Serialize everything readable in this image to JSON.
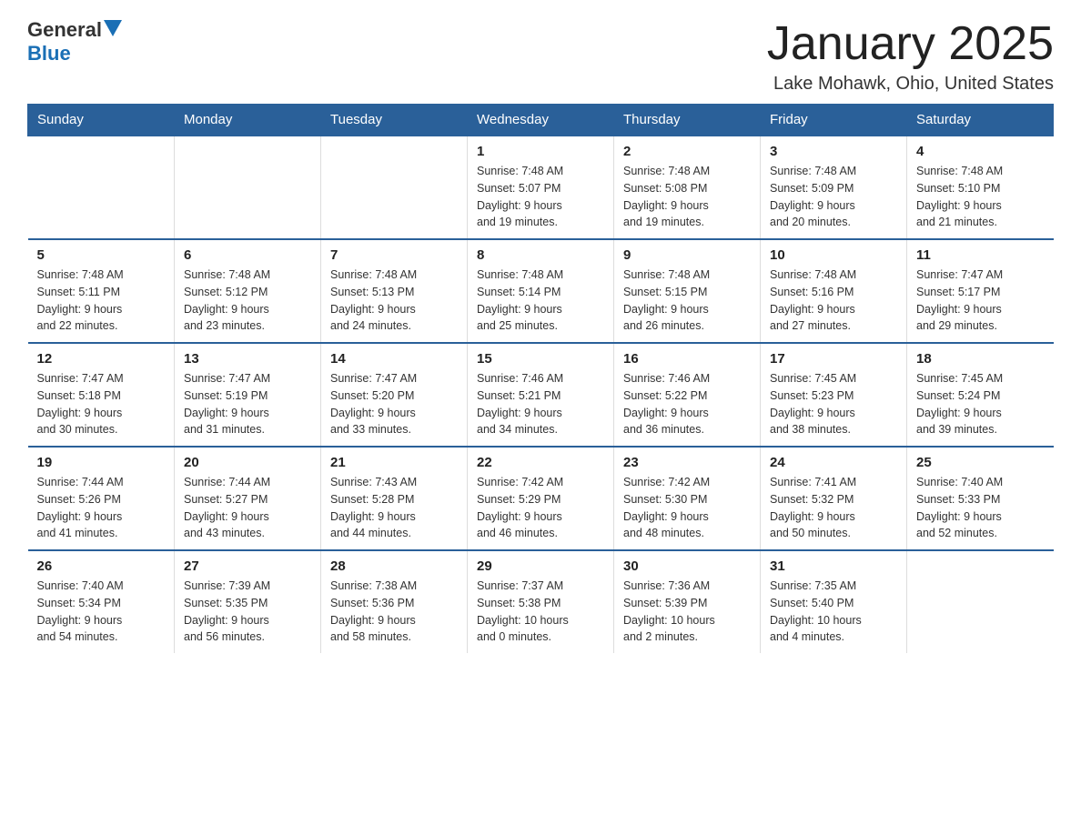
{
  "logo": {
    "general": "General",
    "blue": "Blue"
  },
  "title": "January 2025",
  "subtitle": "Lake Mohawk, Ohio, United States",
  "days_of_week": [
    "Sunday",
    "Monday",
    "Tuesday",
    "Wednesday",
    "Thursday",
    "Friday",
    "Saturday"
  ],
  "weeks": [
    [
      {
        "day": "",
        "info": ""
      },
      {
        "day": "",
        "info": ""
      },
      {
        "day": "",
        "info": ""
      },
      {
        "day": "1",
        "info": "Sunrise: 7:48 AM\nSunset: 5:07 PM\nDaylight: 9 hours\nand 19 minutes."
      },
      {
        "day": "2",
        "info": "Sunrise: 7:48 AM\nSunset: 5:08 PM\nDaylight: 9 hours\nand 19 minutes."
      },
      {
        "day": "3",
        "info": "Sunrise: 7:48 AM\nSunset: 5:09 PM\nDaylight: 9 hours\nand 20 minutes."
      },
      {
        "day": "4",
        "info": "Sunrise: 7:48 AM\nSunset: 5:10 PM\nDaylight: 9 hours\nand 21 minutes."
      }
    ],
    [
      {
        "day": "5",
        "info": "Sunrise: 7:48 AM\nSunset: 5:11 PM\nDaylight: 9 hours\nand 22 minutes."
      },
      {
        "day": "6",
        "info": "Sunrise: 7:48 AM\nSunset: 5:12 PM\nDaylight: 9 hours\nand 23 minutes."
      },
      {
        "day": "7",
        "info": "Sunrise: 7:48 AM\nSunset: 5:13 PM\nDaylight: 9 hours\nand 24 minutes."
      },
      {
        "day": "8",
        "info": "Sunrise: 7:48 AM\nSunset: 5:14 PM\nDaylight: 9 hours\nand 25 minutes."
      },
      {
        "day": "9",
        "info": "Sunrise: 7:48 AM\nSunset: 5:15 PM\nDaylight: 9 hours\nand 26 minutes."
      },
      {
        "day": "10",
        "info": "Sunrise: 7:48 AM\nSunset: 5:16 PM\nDaylight: 9 hours\nand 27 minutes."
      },
      {
        "day": "11",
        "info": "Sunrise: 7:47 AM\nSunset: 5:17 PM\nDaylight: 9 hours\nand 29 minutes."
      }
    ],
    [
      {
        "day": "12",
        "info": "Sunrise: 7:47 AM\nSunset: 5:18 PM\nDaylight: 9 hours\nand 30 minutes."
      },
      {
        "day": "13",
        "info": "Sunrise: 7:47 AM\nSunset: 5:19 PM\nDaylight: 9 hours\nand 31 minutes."
      },
      {
        "day": "14",
        "info": "Sunrise: 7:47 AM\nSunset: 5:20 PM\nDaylight: 9 hours\nand 33 minutes."
      },
      {
        "day": "15",
        "info": "Sunrise: 7:46 AM\nSunset: 5:21 PM\nDaylight: 9 hours\nand 34 minutes."
      },
      {
        "day": "16",
        "info": "Sunrise: 7:46 AM\nSunset: 5:22 PM\nDaylight: 9 hours\nand 36 minutes."
      },
      {
        "day": "17",
        "info": "Sunrise: 7:45 AM\nSunset: 5:23 PM\nDaylight: 9 hours\nand 38 minutes."
      },
      {
        "day": "18",
        "info": "Sunrise: 7:45 AM\nSunset: 5:24 PM\nDaylight: 9 hours\nand 39 minutes."
      }
    ],
    [
      {
        "day": "19",
        "info": "Sunrise: 7:44 AM\nSunset: 5:26 PM\nDaylight: 9 hours\nand 41 minutes."
      },
      {
        "day": "20",
        "info": "Sunrise: 7:44 AM\nSunset: 5:27 PM\nDaylight: 9 hours\nand 43 minutes."
      },
      {
        "day": "21",
        "info": "Sunrise: 7:43 AM\nSunset: 5:28 PM\nDaylight: 9 hours\nand 44 minutes."
      },
      {
        "day": "22",
        "info": "Sunrise: 7:42 AM\nSunset: 5:29 PM\nDaylight: 9 hours\nand 46 minutes."
      },
      {
        "day": "23",
        "info": "Sunrise: 7:42 AM\nSunset: 5:30 PM\nDaylight: 9 hours\nand 48 minutes."
      },
      {
        "day": "24",
        "info": "Sunrise: 7:41 AM\nSunset: 5:32 PM\nDaylight: 9 hours\nand 50 minutes."
      },
      {
        "day": "25",
        "info": "Sunrise: 7:40 AM\nSunset: 5:33 PM\nDaylight: 9 hours\nand 52 minutes."
      }
    ],
    [
      {
        "day": "26",
        "info": "Sunrise: 7:40 AM\nSunset: 5:34 PM\nDaylight: 9 hours\nand 54 minutes."
      },
      {
        "day": "27",
        "info": "Sunrise: 7:39 AM\nSunset: 5:35 PM\nDaylight: 9 hours\nand 56 minutes."
      },
      {
        "day": "28",
        "info": "Sunrise: 7:38 AM\nSunset: 5:36 PM\nDaylight: 9 hours\nand 58 minutes."
      },
      {
        "day": "29",
        "info": "Sunrise: 7:37 AM\nSunset: 5:38 PM\nDaylight: 10 hours\nand 0 minutes."
      },
      {
        "day": "30",
        "info": "Sunrise: 7:36 AM\nSunset: 5:39 PM\nDaylight: 10 hours\nand 2 minutes."
      },
      {
        "day": "31",
        "info": "Sunrise: 7:35 AM\nSunset: 5:40 PM\nDaylight: 10 hours\nand 4 minutes."
      },
      {
        "day": "",
        "info": ""
      }
    ]
  ]
}
